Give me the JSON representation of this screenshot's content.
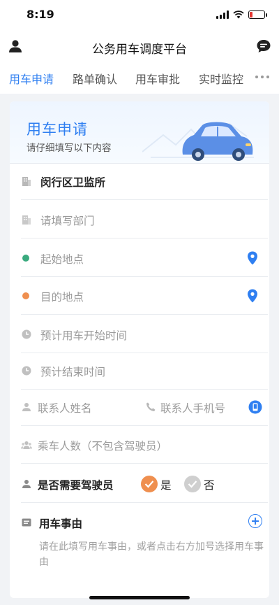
{
  "status_bar": {
    "time": "8:19"
  },
  "nav": {
    "title": "公务用车调度平台"
  },
  "tabs": [
    {
      "label": "用车申请",
      "active": true
    },
    {
      "label": "路单确认",
      "active": false
    },
    {
      "label": "用车审批",
      "active": false
    },
    {
      "label": "实时监控",
      "active": false
    }
  ],
  "header": {
    "title": "用车申请",
    "subtitle": "请仔细填写以下内容"
  },
  "form": {
    "organization": "闵行区卫监所",
    "department_placeholder": "请填写部门",
    "start_placeholder": "起始地点",
    "destination_placeholder": "目的地点",
    "start_time_placeholder": "预计用车开始时间",
    "end_time_placeholder": "预计结束时间",
    "contact_name_placeholder": "联系人姓名",
    "contact_phone_placeholder": "联系人手机号",
    "passengers_placeholder": "乘车人数（不包含驾驶员）",
    "driver_question": "是否需要驾驶员",
    "driver_yes": "是",
    "driver_no": "否",
    "driver_selected": "是",
    "reason_title": "用车事由",
    "reason_placeholder": "请在此填写用车事由，或者点击右方加号选择用车事由"
  },
  "colors": {
    "accent": "#2f7ff1",
    "start_dot": "#3aaa7e",
    "end_dot": "#ef8f4f",
    "radio_on": "#ef8f4f",
    "radio_off": "#cfcfcf"
  },
  "icons": {
    "nav_left": "user-icon",
    "nav_right": "message-icon",
    "location": "location-pin-icon",
    "phone_book": "contact-phone-icon",
    "add": "plus-circle-icon"
  }
}
